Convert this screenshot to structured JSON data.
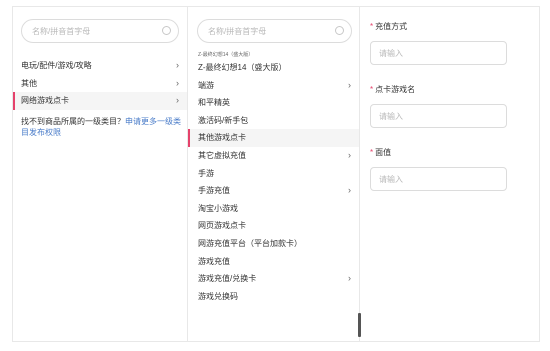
{
  "column1": {
    "search_placeholder": "名称/拼音首字母",
    "items": [
      {
        "label": "电玩/配件/游戏/攻略",
        "chevron": "›"
      },
      {
        "label": "其他",
        "chevron": "›"
      },
      {
        "label": "网络游戏点卡",
        "chevron": "›"
      }
    ],
    "hint_text": "找不到商品所属的一级类目？",
    "hint_link": "申请更多一级类目发布权限"
  },
  "column2": {
    "search_placeholder": "名称/拼音首字母",
    "partial_item": "Z-最终幻想14（盛大版）",
    "items": [
      {
        "label": "Z-最终幻想14（盛大版）",
        "chevron": ""
      },
      {
        "label": "端游",
        "chevron": "›"
      },
      {
        "label": "和平精英",
        "chevron": ""
      },
      {
        "label": "激活码/新手包",
        "chevron": ""
      },
      {
        "label": "其他游戏点卡",
        "chevron": ""
      },
      {
        "label": "其它虚拟充值",
        "chevron": "›"
      },
      {
        "label": "手游",
        "chevron": ""
      },
      {
        "label": "手游充值",
        "chevron": "›"
      },
      {
        "label": "淘宝小游戏",
        "chevron": ""
      },
      {
        "label": "网页游戏点卡",
        "chevron": ""
      },
      {
        "label": "网游充值平台（平台加款卡）",
        "chevron": ""
      },
      {
        "label": "游戏充值",
        "chevron": ""
      },
      {
        "label": "游戏充值/兑换卡",
        "chevron": "›"
      },
      {
        "label": "游戏兑换码",
        "chevron": ""
      }
    ]
  },
  "column3": {
    "fields": [
      {
        "required": "*",
        "label": "充值方式",
        "placeholder": "请输入"
      },
      {
        "required": "*",
        "label": "点卡游戏名",
        "placeholder": "请输入"
      },
      {
        "required": "*",
        "label": "面值",
        "placeholder": "请输入"
      }
    ]
  },
  "colors": {
    "accent": "#e5426b",
    "link": "#4a7cc9",
    "border": "#e8e8e8",
    "active_bg": "#f5f5f5"
  }
}
